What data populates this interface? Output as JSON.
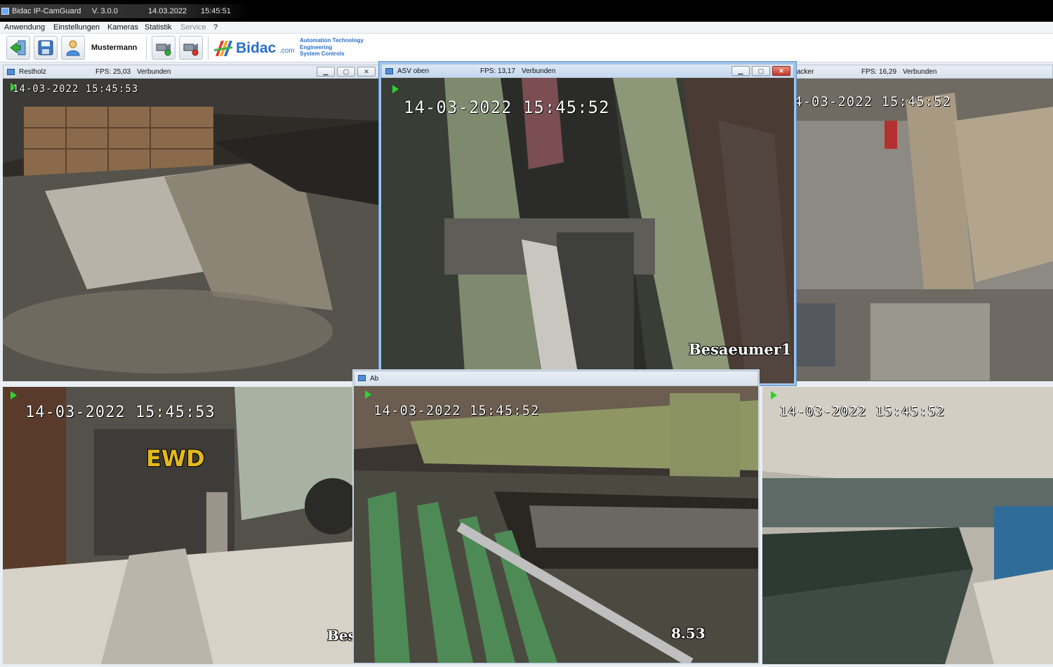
{
  "titlebar": {
    "app": "Bidac IP-CamGuard",
    "version": "V. 3.0.0",
    "date": "14.03.2022",
    "time": "15:45:51"
  },
  "menu": [
    "Anwendung",
    "Einstellungen",
    "Kameras",
    "Statistik",
    "Service",
    "?"
  ],
  "toolbar": {
    "user": "Mustermann",
    "icons": [
      "exit-icon",
      "save-icon",
      "user-icon",
      "camera-add-icon",
      "camera-remove-icon"
    ],
    "logo_text": "Bidac",
    "logo_com": ".com",
    "logo_tag1": "Automation Technology",
    "logo_tag2": "Engineering",
    "logo_tag3": "System Controls"
  },
  "cameras": {
    "restholz": {
      "name": "Restholz",
      "fps": "FPS: 25,03",
      "status": "Verbunden",
      "timestamp": "14-03-2022  15:45:53"
    },
    "asv_oben": {
      "name": "ASV oben",
      "fps": "FPS: 13,17",
      "status": "Verbunden",
      "timestamp": "14-03-2022  15:45:52",
      "overlay": "Besaeumer1"
    },
    "hacker": {
      "name": "acker",
      "fps": "FPS: 16,29",
      "status": "Verbunden",
      "timestamp": "4-03-2022  15:45:52"
    },
    "bottom_left": {
      "timestamp": "14-03-2022  15:45:53",
      "overlay": "Bes",
      "sign": "EWD"
    },
    "bottom_mid": {
      "name": "Ab",
      "timestamp": "14-03-2022  15:45:52",
      "overlay": "8.53"
    },
    "bottom_right": {
      "timestamp": "14-03-2022  15:45:52"
    }
  },
  "colors": {
    "accent": "#2a6fc9",
    "play": "#2bd42b",
    "close": "#c1392b"
  }
}
